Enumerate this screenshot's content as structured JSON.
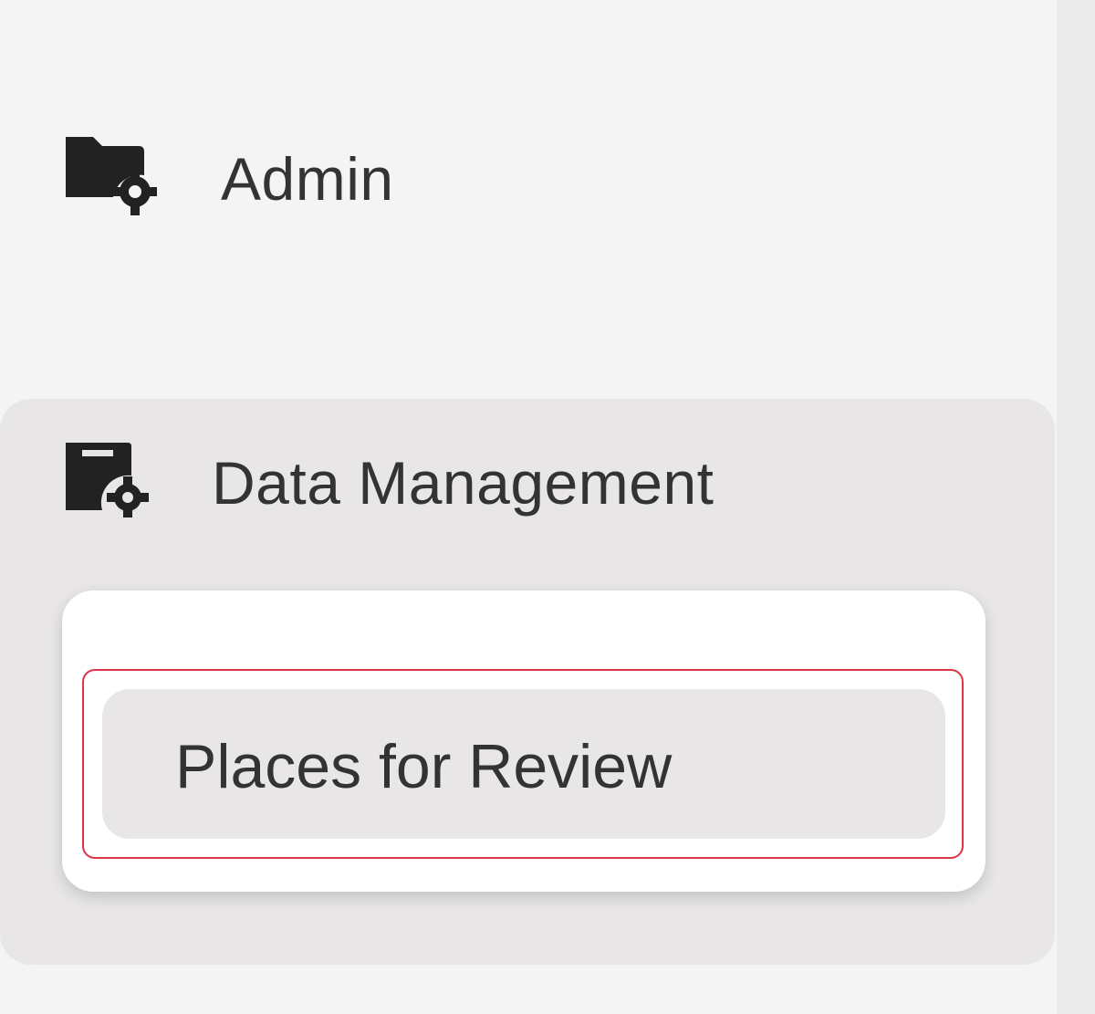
{
  "sidebar": {
    "items": [
      {
        "label": "Admin",
        "icon": "folder-gear-icon"
      },
      {
        "label": "Data Management",
        "icon": "file-gear-icon",
        "expanded": true,
        "children": [
          {
            "label": "Places for Review",
            "active": true
          }
        ]
      }
    ]
  },
  "colors": {
    "sidebar_bg": "#f4f4f4",
    "group_bg": "#e8e6e7",
    "submenu_bg": "#ffffff",
    "text": "#333333",
    "highlight_outline": "#dc3545"
  }
}
